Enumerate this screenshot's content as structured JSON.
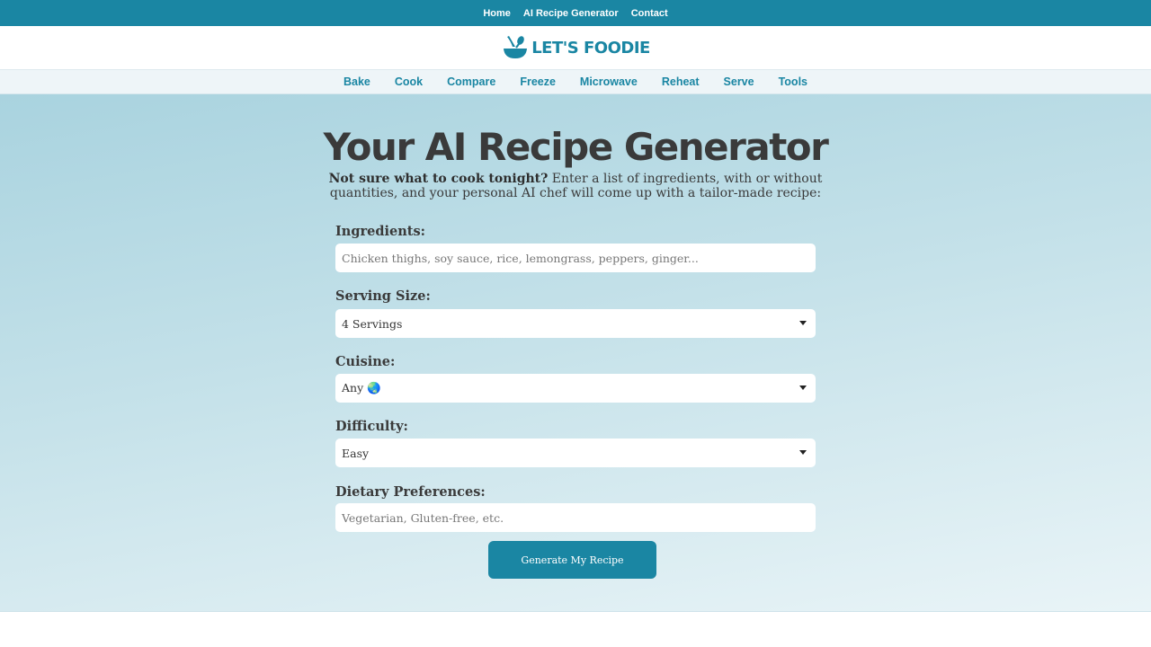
{
  "topnav": {
    "items": [
      "Home",
      "AI Recipe Generator",
      "Contact"
    ]
  },
  "logo": {
    "text": "LET'S FOODIE",
    "icon": "bowl-spoon-icon"
  },
  "catnav": {
    "items": [
      "Bake",
      "Cook",
      "Compare",
      "Freeze",
      "Microwave",
      "Reheat",
      "Serve",
      "Tools"
    ]
  },
  "hero": {
    "title": "Your AI Recipe Generator",
    "intro_bold": "Not sure what to cook tonight?",
    "intro_rest": " Enter a list of ingredients, with or without quantities, and your personal AI chef will come up with a tailor-made recipe:"
  },
  "form": {
    "ingredients": {
      "label": "Ingredients:",
      "placeholder": "Chicken thighs, soy sauce, rice, lemongrass, peppers, ginger..."
    },
    "serving": {
      "label": "Serving Size:",
      "value": "4 Servings"
    },
    "cuisine": {
      "label": "Cuisine:",
      "value": "Any 🌏"
    },
    "difficulty": {
      "label": "Difficulty:",
      "value": "Easy"
    },
    "dietary": {
      "label": "Dietary Preferences:",
      "placeholder": "Vegetarian, Gluten-free, etc."
    },
    "submit_label": "Generate My Recipe"
  },
  "colors": {
    "brand": "#1a86a3",
    "text": "#3a3a3a"
  }
}
